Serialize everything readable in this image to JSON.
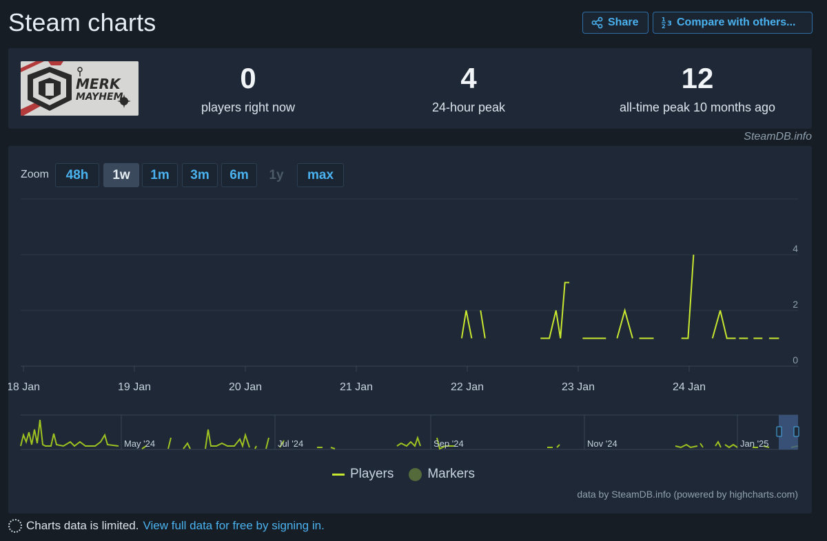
{
  "header": {
    "title": "Steam charts",
    "share_label": "Share",
    "compare_label": "Compare with others..."
  },
  "stats": {
    "logo_text": [
      "MERK",
      "MAYHEM"
    ],
    "players_now": {
      "value": "0",
      "label": "players right now"
    },
    "peak_24h": {
      "value": "4",
      "label": "24-hour peak"
    },
    "all_time_peak": {
      "value": "12",
      "label": "all-time peak 10 months ago"
    }
  },
  "watermark": "SteamDB.info",
  "zoom": {
    "label": "Zoom",
    "buttons": [
      {
        "label": "48h",
        "state": "normal"
      },
      {
        "label": "1w",
        "state": "active"
      },
      {
        "label": "1m",
        "state": "normal"
      },
      {
        "label": "3m",
        "state": "normal"
      },
      {
        "label": "6m",
        "state": "normal"
      },
      {
        "label": "1y",
        "state": "disabled"
      },
      {
        "label": "max",
        "state": "normal"
      }
    ]
  },
  "chart_data": {
    "type": "line",
    "x_tick_labels": [
      "18 Jan",
      "19 Jan",
      "20 Jan",
      "21 Jan",
      "22 Jan",
      "23 Jan",
      "24 Jan"
    ],
    "y_tick_labels": [
      "0",
      "2",
      "4"
    ],
    "ylim": [
      0,
      6
    ],
    "grid": true,
    "series": [
      {
        "name": "Players",
        "color": "#c9e830",
        "segments": [
          [
            [
              21.95,
              1
            ],
            [
              21.99,
              2
            ],
            [
              22.04,
              1
            ]
          ],
          [
            [
              22.12,
              2
            ],
            [
              22.16,
              1
            ]
          ],
          [
            [
              22.66,
              1
            ],
            [
              22.74,
              1
            ],
            [
              22.8,
              2
            ],
            [
              22.84,
              1
            ],
            [
              22.88,
              3
            ],
            [
              22.92,
              3
            ]
          ],
          [
            [
              23.04,
              1
            ],
            [
              23.25,
              1
            ]
          ],
          [
            [
              23.35,
              1
            ],
            [
              23.42,
              2
            ],
            [
              23.49,
              1
            ]
          ],
          [
            [
              23.55,
              1
            ],
            [
              23.68,
              1
            ]
          ],
          [
            [
              23.93,
              1
            ],
            [
              23.99,
              1
            ],
            [
              24.04,
              4
            ]
          ],
          [
            [
              24.21,
              1
            ],
            [
              24.28,
              2
            ],
            [
              24.34,
              1
            ],
            [
              24.42,
              1
            ]
          ],
          [
            [
              24.45,
              1
            ],
            [
              24.53,
              1
            ]
          ],
          [
            [
              24.58,
              1
            ],
            [
              24.66,
              1
            ]
          ],
          [
            [
              24.72,
              1
            ],
            [
              24.81,
              1
            ]
          ]
        ]
      }
    ],
    "navigator": {
      "tick_labels": [
        "May '24",
        "Jul '24",
        "Sep '24",
        "Nov '24",
        "Jan '25"
      ]
    },
    "legend": [
      "Players",
      "Markers"
    ]
  },
  "credit": "data by SteamDB.info (powered by highcharts.com)",
  "footer": {
    "notice": "Charts data is limited.",
    "link": "View full data for free by signing in."
  },
  "colors": {
    "background": "#171d25",
    "panel": "#1f2836",
    "accent": "#4ab2ef",
    "series": "#c9e830"
  }
}
